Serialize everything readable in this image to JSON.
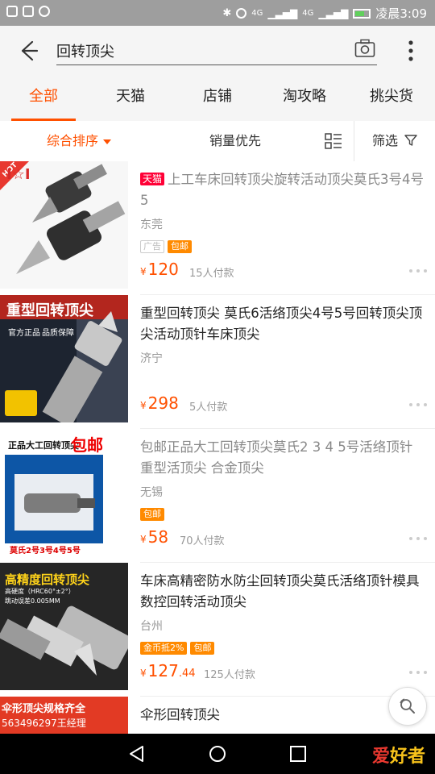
{
  "status_bar": {
    "time_text": "凌晨3:09",
    "signal_1": "4G",
    "signal_2": "4G"
  },
  "search": {
    "query": "回转顶尖"
  },
  "tabs": [
    {
      "label": "全部",
      "active": true
    },
    {
      "label": "天猫",
      "active": false
    },
    {
      "label": "店铺",
      "active": false
    },
    {
      "label": "淘攻略",
      "active": false
    },
    {
      "label": "挑尖货",
      "active": false
    }
  ],
  "sort": {
    "comprehensive": "综合排序",
    "sales": "销量优先",
    "filter": "筛选"
  },
  "products": [
    {
      "title": "上工车床回转顶尖旋转活动顶尖莫氏3号4号5",
      "tmall_badge": "天猫",
      "location": "东莞",
      "tags": [
        "广告",
        "包邮"
      ],
      "price_yen": "¥",
      "price": "120",
      "price_decimal": "",
      "sold": "15人付款",
      "thumb_text_1": "I☆I",
      "hot_label": "HOT"
    },
    {
      "title": "重型回转顶尖 莫氏6活络顶尖4号5号回转顶尖顶尖活动顶针车床顶尖",
      "location": "济宁",
      "tags": [],
      "price_yen": "¥",
      "price": "298",
      "price_decimal": "",
      "sold": "5人付款",
      "thumb_text_1": "重型回转顶尖",
      "thumb_text_2": "官方正品",
      "thumb_text_3": "品质保障"
    },
    {
      "title": "包邮正品大工回转顶尖莫氏2 3 4 5号活络顶针重型活顶尖 合金顶尖",
      "location": "无锡",
      "tags": [
        "包邮"
      ],
      "price_yen": "¥",
      "price": "58",
      "price_decimal": "",
      "sold": "70人付款",
      "thumb_text_1": "正品大工回转顶尖",
      "thumb_text_2": "包邮",
      "thumb_text_3": "莫氏2号3号4号5号"
    },
    {
      "title": "车床高精密防水防尘回转顶尖莫氏活络顶针模具数控回转活动顶尖",
      "location": "台州",
      "tags": [
        "金币抵2%",
        "包邮"
      ],
      "price_yen": "¥",
      "price": "127",
      "price_decimal": ".44",
      "sold": "125人付款",
      "thumb_text_1": "高精度回转顶尖",
      "thumb_text_2": "高硬度（HRC60°±2°）",
      "thumb_text_3": "跳动误差0.005MM"
    },
    {
      "title": "伞形回转顶尖",
      "thumb_text_1": "伞形顶尖规格齐全",
      "thumb_text_2": "563496297王经理"
    }
  ],
  "watermark": {
    "text_a": "爱",
    "text_b": "好者"
  },
  "colors": {
    "accent": "#ff5000",
    "tmall": "#ff0036",
    "tag_orange": "#ff8a00"
  }
}
